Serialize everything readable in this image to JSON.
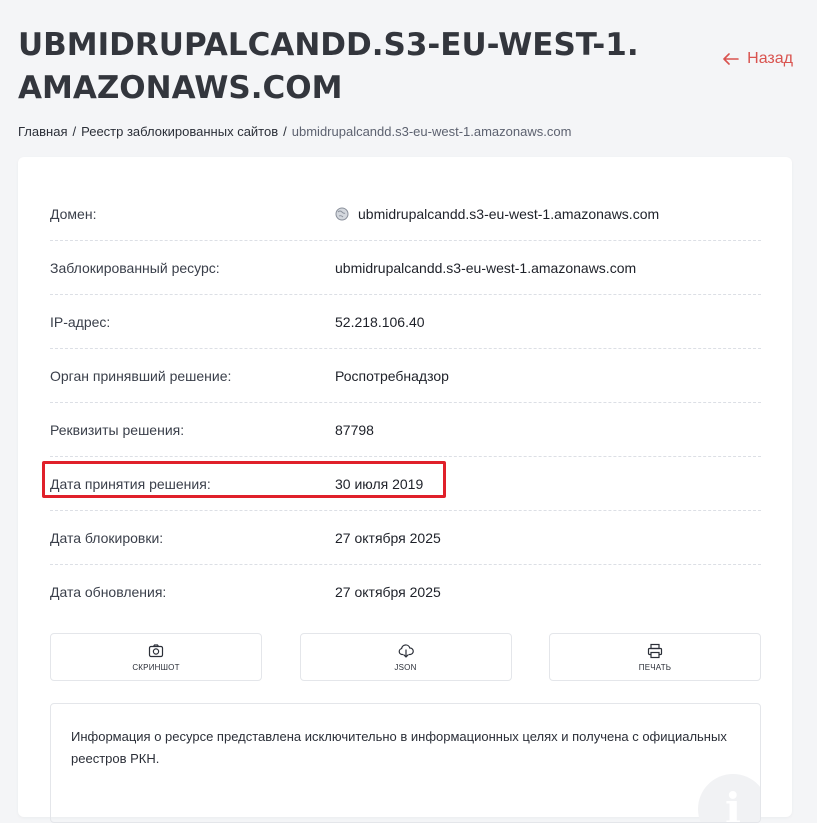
{
  "page": {
    "title": "UBMIDRUPALCANDD.S3-EU-WEST-1.AMAZONAWS.COM",
    "back_label": "Назад"
  },
  "breadcrumb": {
    "home": "Главная",
    "registry": "Реестр заблокированных сайтов",
    "current": "ubmidrupalcandd.s3-eu-west-1.amazonaws.com",
    "separator": "/"
  },
  "details": [
    {
      "label": "Домен:",
      "value": "ubmidrupalcandd.s3-eu-west-1.amazonaws.com",
      "icon": "globe-icon"
    },
    {
      "label": "Заблокированный ресурс:",
      "value": "ubmidrupalcandd.s3-eu-west-1.amazonaws.com"
    },
    {
      "label": "IP-адрес:",
      "value": "52.218.106.40"
    },
    {
      "label": "Орган принявший решение:",
      "value": "Роспотребнадзор"
    },
    {
      "label": "Реквизиты решения:",
      "value": "87798"
    },
    {
      "label": "Дата принятия решения:",
      "value": "30 июля 2019",
      "highlighted": true
    },
    {
      "label": "Дата блокировки:",
      "value": "27 октября 2025"
    },
    {
      "label": "Дата обновления:",
      "value": "27 октября 2025"
    }
  ],
  "actions": {
    "screenshot": "СКРИНШОТ",
    "json": "JSON",
    "print": "ПЕЧАТЬ"
  },
  "info": {
    "text": "Информация о ресурсе представлена исключительно в информационных целях и получена с официальных реестров РКН.",
    "icon": "info-icon"
  },
  "colors": {
    "accent": "#d9534f",
    "highlight_border": "#e0202a",
    "background": "#f4f5f7"
  }
}
